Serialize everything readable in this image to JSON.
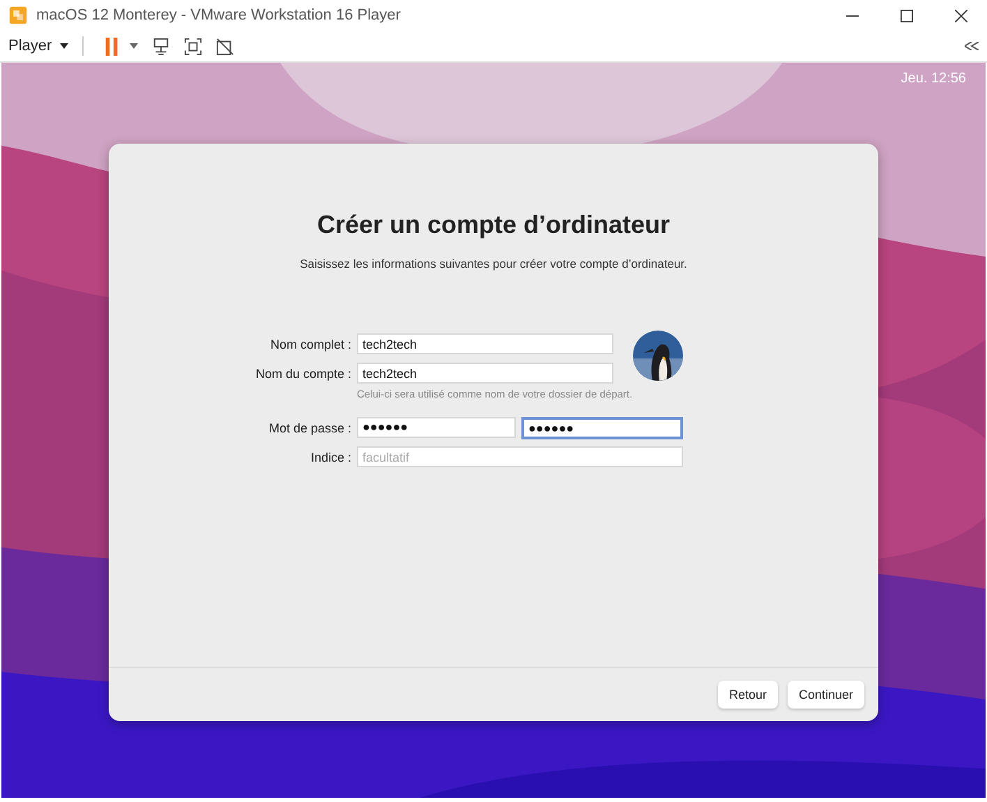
{
  "window": {
    "title": "macOS 12 Monterey - VMware Workstation 16 Player"
  },
  "toolbar": {
    "menu": "Player"
  },
  "menu_bar": {
    "clock": "Jeu. 12:56"
  },
  "dialog": {
    "title": "Créer un compte d’ordinateur",
    "subtitle": "Saisissez les informations suivantes pour créer votre compte d’ordinateur.",
    "rows": [
      {
        "label": "Nom complet :",
        "inputs": [
          {
            "value": "tech2tech",
            "focused": false
          }
        ]
      },
      {
        "label": "Nom du compte :",
        "inputs": [
          {
            "value": "tech2tech",
            "focused": false
          }
        ],
        "hint": "Celui-ci sera utilisé comme nom de votre dossier de départ."
      },
      {
        "label": "Mot de passe :",
        "inputs": [
          {
            "value": "●●●●●●",
            "focused": false
          },
          {
            "value": "●●●●●●",
            "focused": true
          }
        ]
      },
      {
        "label": "Indice :",
        "inputs": [
          {
            "placeholder": "facultatif",
            "focused": false
          }
        ]
      }
    ],
    "buttons": [
      "Retour",
      "Continuer"
    ]
  }
}
